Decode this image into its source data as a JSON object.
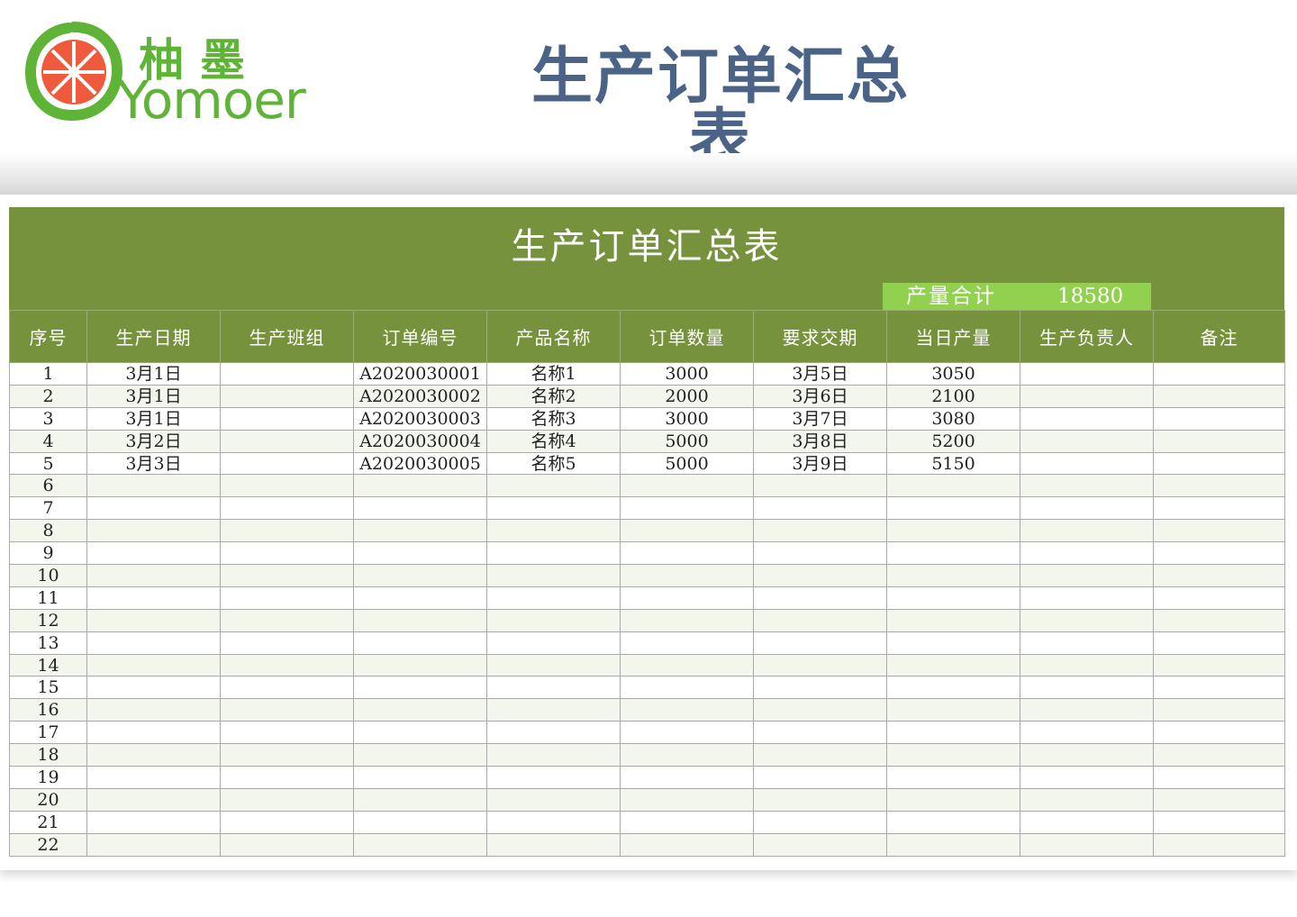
{
  "brand": {
    "name_cn": "柚墨",
    "name_en": "Yomoer",
    "colors": {
      "green": "#5fb336",
      "orange": "#f05a3c"
    }
  },
  "page_title": "生产订单汇总表",
  "sheet": {
    "title": "生产订单汇总表",
    "total_label": "产量合计",
    "total_value": "18580",
    "colors": {
      "header": "#76923c",
      "total": "#92d050",
      "row_alt": "#f3f6ec",
      "title": "#4a6387"
    },
    "columns": [
      "序号",
      "生产日期",
      "生产班组",
      "订单编号",
      "产品名称",
      "订单数量",
      "要求交期",
      "当日产量",
      "生产负责人",
      "备注"
    ],
    "rows": [
      [
        "1",
        "3月1日",
        "",
        "A2020030001",
        "名称1",
        "3000",
        "3月5日",
        "3050",
        "",
        ""
      ],
      [
        "2",
        "3月1日",
        "",
        "A2020030002",
        "名称2",
        "2000",
        "3月6日",
        "2100",
        "",
        ""
      ],
      [
        "3",
        "3月1日",
        "",
        "A2020030003",
        "名称3",
        "3000",
        "3月7日",
        "3080",
        "",
        ""
      ],
      [
        "4",
        "3月2日",
        "",
        "A2020030004",
        "名称4",
        "5000",
        "3月8日",
        "5200",
        "",
        ""
      ],
      [
        "5",
        "3月3日",
        "",
        "A2020030005",
        "名称5",
        "5000",
        "3月9日",
        "5150",
        "",
        ""
      ],
      [
        "6",
        "",
        "",
        "",
        "",
        "",
        "",
        "",
        "",
        ""
      ],
      [
        "7",
        "",
        "",
        "",
        "",
        "",
        "",
        "",
        "",
        ""
      ],
      [
        "8",
        "",
        "",
        "",
        "",
        "",
        "",
        "",
        "",
        ""
      ],
      [
        "9",
        "",
        "",
        "",
        "",
        "",
        "",
        "",
        "",
        ""
      ],
      [
        "10",
        "",
        "",
        "",
        "",
        "",
        "",
        "",
        "",
        ""
      ],
      [
        "11",
        "",
        "",
        "",
        "",
        "",
        "",
        "",
        "",
        ""
      ],
      [
        "12",
        "",
        "",
        "",
        "",
        "",
        "",
        "",
        "",
        ""
      ],
      [
        "13",
        "",
        "",
        "",
        "",
        "",
        "",
        "",
        "",
        ""
      ],
      [
        "14",
        "",
        "",
        "",
        "",
        "",
        "",
        "",
        "",
        ""
      ],
      [
        "15",
        "",
        "",
        "",
        "",
        "",
        "",
        "",
        "",
        ""
      ],
      [
        "16",
        "",
        "",
        "",
        "",
        "",
        "",
        "",
        "",
        ""
      ],
      [
        "17",
        "",
        "",
        "",
        "",
        "",
        "",
        "",
        "",
        ""
      ],
      [
        "18",
        "",
        "",
        "",
        "",
        "",
        "",
        "",
        "",
        ""
      ],
      [
        "19",
        "",
        "",
        "",
        "",
        "",
        "",
        "",
        "",
        ""
      ],
      [
        "20",
        "",
        "",
        "",
        "",
        "",
        "",
        "",
        "",
        ""
      ],
      [
        "21",
        "",
        "",
        "",
        "",
        "",
        "",
        "",
        "",
        ""
      ],
      [
        "22",
        "",
        "",
        "",
        "",
        "",
        "",
        "",
        "",
        ""
      ]
    ]
  }
}
